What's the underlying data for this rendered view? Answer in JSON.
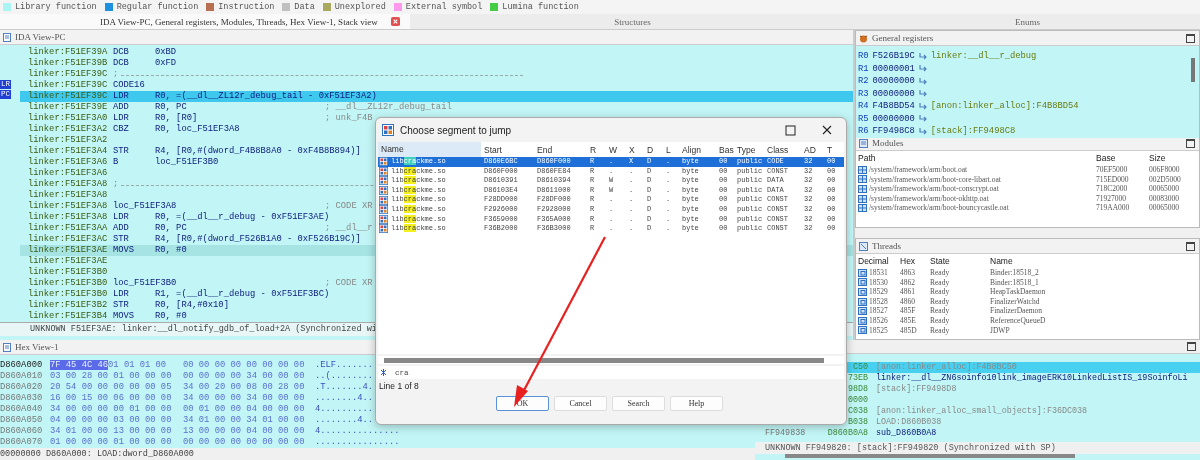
{
  "legend": [
    {
      "label": "Library function",
      "color": "#aaf4f4"
    },
    {
      "label": "Regular function",
      "color": "#1e90e0"
    },
    {
      "label": "Instruction",
      "color": "#b87050"
    },
    {
      "label": "Data",
      "color": "#c0c0c0"
    },
    {
      "label": "Unexplored",
      "color": "#a8a860"
    },
    {
      "label": "External symbol",
      "color": "#ff99ee"
    },
    {
      "label": "Lumina function",
      "color": "#44cc44"
    }
  ],
  "tabs": [
    {
      "label": "IDA View-PC, General registers, Modules, Threads, Hex View-1, Stack view",
      "selected": true,
      "closable": true
    },
    {
      "label": "Structures",
      "selected": false,
      "closable": false
    },
    {
      "label": "Enums",
      "selected": false,
      "closable": false
    }
  ],
  "ida_view": {
    "title": "IDA View-PC",
    "lines": [
      {
        "kind": "code",
        "address": "linker:F51EF39A",
        "mnemonic": "DCB",
        "operands": "0xBD",
        "current": false,
        "selected": false
      },
      {
        "kind": "code",
        "address": "linker:F51EF39B",
        "mnemonic": "DCB",
        "operands": "0xFD",
        "current": false,
        "selected": false
      },
      {
        "kind": "separator",
        "address": "linker:F51EF39C",
        "text": ";",
        "current": false,
        "selected": false
      },
      {
        "kind": "code",
        "address": "linker:F51EF39C",
        "mnemonic": "CODE16",
        "current": false,
        "selected": false
      },
      {
        "kind": "code",
        "address": "linker:F51EF39C",
        "mnemonic": "LDR",
        "operands": "R0, =(__dl__ZL12r_debug_tail - 0xF51EF3A2)",
        "current": true,
        "selected": false,
        "markers": [
          "LR",
          "PC"
        ]
      },
      {
        "kind": "code",
        "address": "linker:F51EF39E",
        "mnemonic": "ADD",
        "operands": "R0, PC",
        "comment": "; __dl__ZL12r_debug_tail",
        "current": false,
        "selected": false
      },
      {
        "kind": "code",
        "address": "linker:F51EF3A0",
        "mnemonic": "LDR",
        "operands": "R0, [R0]",
        "comment": "; unk_F4B",
        "current": false,
        "selected": false
      },
      {
        "kind": "code",
        "address": "linker:F51EF3A2",
        "mnemonic": "CBZ",
        "operands": "R0, loc_F51EF3A8",
        "current": false,
        "selected": false
      },
      {
        "kind": "code",
        "address": "linker:F51EF3A2",
        "current": false,
        "selected": false
      },
      {
        "kind": "code",
        "address": "linker:F51EF3A4",
        "mnemonic": "STR",
        "operands": "R4, [R0,#(dword_F4B8B8A0 - 0xF4B8B894)]",
        "current": false,
        "selected": false
      },
      {
        "kind": "code",
        "address": "linker:F51EF3A6",
        "mnemonic": "B",
        "operands": "loc_F51EF3B0",
        "current": false,
        "selected": false
      },
      {
        "kind": "code",
        "address": "linker:F51EF3A6",
        "current": false,
        "selected": false
      },
      {
        "kind": "separator",
        "address": "linker:F51EF3A8",
        "text": ";",
        "current": false,
        "selected": false
      },
      {
        "kind": "code",
        "address": "linker:F51EF3A8",
        "current": false,
        "selected": false
      },
      {
        "kind": "label",
        "address": "linker:F51EF3A8",
        "label": "loc_F51EF3A8",
        "comment": "; CODE XR",
        "current": false,
        "selected": false
      },
      {
        "kind": "code",
        "address": "linker:F51EF3A8",
        "mnemonic": "LDR",
        "operands": "R0, =(__dl__r_debug - 0xF51EF3AE)",
        "current": false,
        "selected": false
      },
      {
        "kind": "code",
        "address": "linker:F51EF3AA",
        "mnemonic": "ADD",
        "operands": "R0, PC",
        "comment": "; __dl__r",
        "current": false,
        "selected": false
      },
      {
        "kind": "code",
        "address": "linker:F51EF3AC",
        "mnemonic": "STR",
        "operands": "R4, [R0,#(dword_F526B1A0 - 0xF526B19C)]",
        "current": false,
        "selected": false
      },
      {
        "kind": "code",
        "address": "linker:F51EF3AE",
        "mnemonic": "MOVS",
        "operands": "R0, #0",
        "current": false,
        "selected": true
      },
      {
        "kind": "code",
        "address": "linker:F51EF3AE",
        "current": false,
        "selected": false
      },
      {
        "kind": "code",
        "address": "linker:F51EF3B0",
        "current": false,
        "selected": false
      },
      {
        "kind": "label",
        "address": "linker:F51EF3B0",
        "label": "loc_F51EF3B0",
        "comment": "; CODE XR",
        "current": false,
        "selected": false
      },
      {
        "kind": "code",
        "address": "linker:F51EF3B0",
        "mnemonic": "LDR",
        "operands": "R1, =(__dl__r_debug - 0xF51EF3BC)",
        "current": false,
        "selected": false
      },
      {
        "kind": "code",
        "address": "linker:F51EF3B2",
        "mnemonic": "STR",
        "operands": "R0, [R4,#0x10]",
        "current": false,
        "selected": false
      },
      {
        "kind": "code",
        "address": "linker:F51EF3B4",
        "mnemonic": "MOVS",
        "operands": "R0, #0",
        "current": false,
        "selected": false
      }
    ],
    "status": "UNKNOWN F51EF3AE: linker:__dl_notify_gdb_of_load+2A (Synchronized wi"
  },
  "general_registers": {
    "title": "General registers",
    "rows": [
      {
        "register": "R0",
        "value": "F526B19C",
        "symbol": "linker:__dl__r_debug"
      },
      {
        "register": "R1",
        "value": "00000001"
      },
      {
        "register": "R2",
        "value": "00000000"
      },
      {
        "register": "R3",
        "value": "00000000"
      },
      {
        "register": "R4",
        "value": "F4B8BD54",
        "symbol": "[anon:linker_alloc]:F4B8BD54"
      },
      {
        "register": "R5",
        "value": "00000000"
      },
      {
        "register": "R6",
        "value": "FF9498C8",
        "symbol": "[stack]:FF9498C8"
      }
    ]
  },
  "modules": {
    "title": "Modules",
    "columns": [
      "Path",
      "Base",
      "Size"
    ],
    "rows": [
      [
        "/system/framework/arm/boot.oat",
        "70EF5000",
        "006F8000"
      ],
      [
        "/system/framework/arm/boot-core-libart.oat",
        "715ED000",
        "002D5000"
      ],
      [
        "/system/framework/arm/boot-conscrypt.oat",
        "718C2000",
        "00065000"
      ],
      [
        "/system/framework/arm/boot-okhttp.oat",
        "71927000",
        "00083000"
      ],
      [
        "/system/framework/arm/boot-bouncycastle.oat",
        "719AA000",
        "00065000"
      ]
    ]
  },
  "threads": {
    "title": "Threads",
    "columns": [
      "Decimal",
      "Hex",
      "State",
      "Name"
    ],
    "rows": [
      [
        "18531",
        "4863",
        "Ready",
        "Binder:18518_2"
      ],
      [
        "18530",
        "4862",
        "Ready",
        "Binder:18518_1"
      ],
      [
        "18529",
        "4861",
        "Ready",
        "HeapTaskDaemon"
      ],
      [
        "18528",
        "4860",
        "Ready",
        "FinalizerWatchd"
      ],
      [
        "18527",
        "485F",
        "Ready",
        "FinalizerDaemon"
      ],
      [
        "18526",
        "485E",
        "Ready",
        "ReferenceQueueD"
      ],
      [
        "18525",
        "485D",
        "Ready",
        "JDWP"
      ]
    ]
  },
  "hex_view": {
    "title": "Hex View-1",
    "rows": [
      {
        "address": "D860A000",
        "marked": "7F 45 4C 46",
        "bytes": [
          "01 01 01 00",
          "00 00 00 00 00 00 00 00"
        ],
        "ascii": ".ELF......."
      },
      {
        "address": "D860A010",
        "bytes": [
          "03 00 28 00 01 00 00 00",
          "00 00 00 00 34 00 00 00"
        ],
        "ascii": "..(........"
      },
      {
        "address": "D860A020",
        "bytes": [
          "20 54 00 00 00 00 00 05",
          "34 00 20 00 08 00 28 00"
        ],
        "ascii": ".T.......4."
      },
      {
        "address": "D860A030",
        "bytes": [
          "16 00 15 00 06 00 00 00",
          "34 00 00 00 34 00 00 00"
        ],
        "ascii": "........4.."
      },
      {
        "address": "D860A040",
        "bytes": [
          "34 00 00 00 00 01 00 00",
          "00 01 00 00 04 00 00 00"
        ],
        "ascii": "4.........."
      },
      {
        "address": "D860A050",
        "bytes": [
          "04 00 00 00 03 00 00 00",
          "34 01 00 00 34 01 00 00"
        ],
        "ascii": "........4.."
      },
      {
        "address": "D860A060",
        "bytes": [
          "34 01 00 00 13 00 00 00",
          "13 00 00 00 04 00 00 00"
        ],
        "ascii": "4..............."
      },
      {
        "address": "D860A070",
        "bytes": [
          "01 00 00 00 01 00 00 00",
          "00 00 00 00 00 00 00 00"
        ],
        "ascii": "................"
      }
    ],
    "status": "00000000 D860A000: LOAD:dword_D860A000"
  },
  "stack_view": {
    "rows": [
      {
        "value": "C50",
        "symbol": "[anon:linker_alloc]:F4B8BC50",
        "selected": true
      },
      {
        "value": "73EB",
        "symbol": "linker:__dl__ZN6soinfo10link_imageERK10LinkedListIS_19SoinfoLi",
        "selected": false
      },
      {
        "value": "98D8",
        "symbol": "[stack]:FF9498D8",
        "selected": false
      },
      {
        "value": "0000",
        "selected": false
      },
      {
        "value": "C038",
        "symbol": "[anon:linker_alloc_small_objects]:F36DC038",
        "selected": false
      },
      {
        "value": "B038",
        "symbol": "LOAD:D860B038",
        "selected": false
      },
      {
        "address": "FF949838",
        "value": "D860B0A8",
        "symbol": "sub_D860B0A8",
        "selected": false
      }
    ],
    "status": "UNKNOWN FF949820: [stack]:FF949820 (Synchronized with SP)"
  },
  "dialog": {
    "title": "Choose segment to jump",
    "name_column": "Name",
    "columns": [
      "Start",
      "End",
      "R",
      "W",
      "X",
      "D",
      "L",
      "Align",
      "Bas",
      "Type",
      "Class",
      "AD",
      "T"
    ],
    "rows": [
      {
        "name": [
          "lib",
          "cra",
          "ckme.so"
        ],
        "cells": [
          "D860E6BC",
          "D860F000",
          "R",
          ".",
          "X",
          "D",
          ".",
          "byte",
          "00",
          "public",
          "CODE",
          "32",
          "00"
        ],
        "selected": true
      },
      {
        "name": [
          "lib",
          "cra",
          "ckme.so"
        ],
        "cells": [
          "D860F000",
          "D860FE84",
          "R",
          ".",
          ".",
          "D",
          ".",
          "byte",
          "00",
          "public",
          "CONST",
          "32",
          "00"
        ],
        "selected": false
      },
      {
        "name": [
          "lib",
          "cra",
          "ckme.so"
        ],
        "cells": [
          "D8610391",
          "D8610394",
          "R",
          "W",
          ".",
          "D",
          ".",
          "byte",
          "00",
          "public",
          "DATA",
          "32",
          "00"
        ],
        "selected": false
      },
      {
        "name": [
          "lib",
          "cra",
          "ckme.so"
        ],
        "cells": [
          "D86103E4",
          "D8611000",
          "R",
          "W",
          ".",
          "D",
          ".",
          "byte",
          "00",
          "public",
          "DATA",
          "32",
          "00"
        ],
        "selected": false
      },
      {
        "name": [
          "lib",
          "cra",
          "ckme.so"
        ],
        "cells": [
          "F28DD000",
          "F28DF000",
          "R",
          ".",
          ".",
          "D",
          ".",
          "byte",
          "00",
          "public",
          "CONST",
          "32",
          "00"
        ],
        "selected": false
      },
      {
        "name": [
          "lib",
          "cra",
          "ckme.so"
        ],
        "cells": [
          "F2926000",
          "F2928000",
          "R",
          ".",
          ".",
          "D",
          ".",
          "byte",
          "00",
          "public",
          "CONST",
          "32",
          "00"
        ],
        "selected": false
      },
      {
        "name": [
          "lib",
          "cra",
          "ckme.so"
        ],
        "cells": [
          "F3659000",
          "F365A000",
          "R",
          ".",
          ".",
          "D",
          ".",
          "byte",
          "00",
          "public",
          "CONST",
          "32",
          "00"
        ],
        "selected": false
      },
      {
        "name": [
          "lib",
          "cra",
          "ckme.so"
        ],
        "cells": [
          "F36B2000",
          "F36B3000",
          "R",
          ".",
          ".",
          "D",
          ".",
          "byte",
          "00",
          "public",
          "CONST",
          "32",
          "00"
        ],
        "selected": false
      }
    ],
    "search": {
      "value": "cra"
    },
    "status": "Line 1 of 8",
    "buttons": [
      {
        "label": "OK",
        "default": true
      },
      {
        "label": "Cancel",
        "default": false
      },
      {
        "label": "Search",
        "default": false
      },
      {
        "label": "Help",
        "default": false
      }
    ]
  }
}
